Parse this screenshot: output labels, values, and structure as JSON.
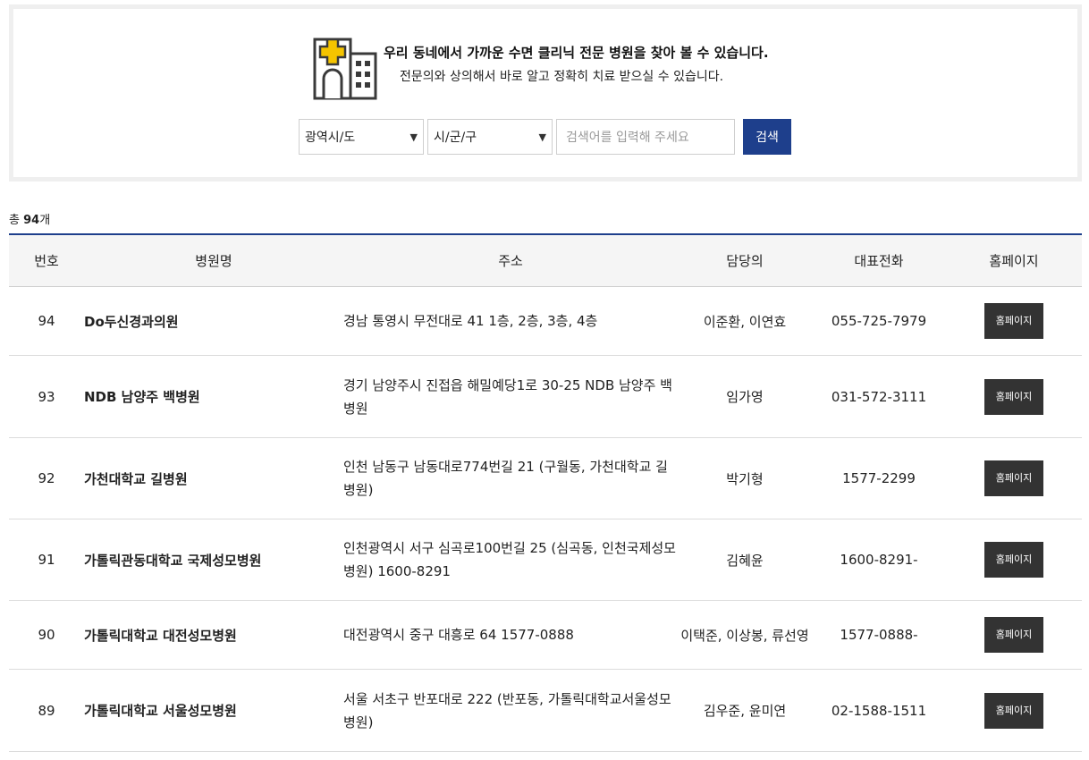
{
  "header": {
    "title": "우리 동네에서 가까운 수면 클리닉 전문 병원을 찾아 볼 수 있습니다.",
    "subtitle": "전문의와 상의해서 바로 알고 정확히 치료 받으실 수 있습니다.",
    "icon": "hospital-icon"
  },
  "search": {
    "province_select": "광역시/도",
    "city_select": "시/군/구",
    "placeholder": "검색어를 입력해 주세요",
    "button_label": "검색",
    "accent_color": "#1e3f8c"
  },
  "summary": {
    "prefix": "총 ",
    "count": "94",
    "suffix": "개"
  },
  "table": {
    "columns": [
      "번호",
      "병원명",
      "주소",
      "담당의",
      "대표전화",
      "홈페이지"
    ],
    "rows": [
      {
        "no": "94",
        "name": "Do두신경과의원",
        "address": "경남 통영시 무전대로 41 1층, 2층, 3층, 4층",
        "doctor": "이준환, 이연효",
        "phone": "055-725-7979",
        "home": "홈페이지"
      },
      {
        "no": "93",
        "name": "NDB 남양주 백병원",
        "address": "경기 남양주시 진접읍 해밀예당1로 30-25 NDB 남양주 백병원",
        "doctor": "임가영",
        "phone": "031-572-3111",
        "home": "홈페이지"
      },
      {
        "no": "92",
        "name": "가천대학교 길병원",
        "address": "인천 남동구 남동대로774번길 21 (구월동, 가천대학교 길병원)",
        "doctor": "박기형",
        "phone": "1577-2299",
        "home": "홈페이지"
      },
      {
        "no": "91",
        "name": "가톨릭관동대학교 국제성모병원",
        "address": "인천광역시 서구 심곡로100번길 25 (심곡동, 인천국제성모병원) 1600-8291",
        "doctor": "김혜윤",
        "phone": "1600-8291-",
        "home": "홈페이지"
      },
      {
        "no": "90",
        "name": "가톨릭대학교 대전성모병원",
        "address": "대전광역시 중구 대흥로 64 1577-0888",
        "doctor": "이택준, 이상봉, 류선영",
        "phone": "1577-0888-",
        "home": "홈페이지"
      },
      {
        "no": "89",
        "name": "가톨릭대학교 서울성모병원",
        "address": "서울 서초구 반포대로 222 (반포동, 가톨릭대학교서울성모병원)",
        "doctor": "김우준, 윤미연",
        "phone": "02-1588-1511",
        "home": "홈페이지"
      }
    ]
  }
}
